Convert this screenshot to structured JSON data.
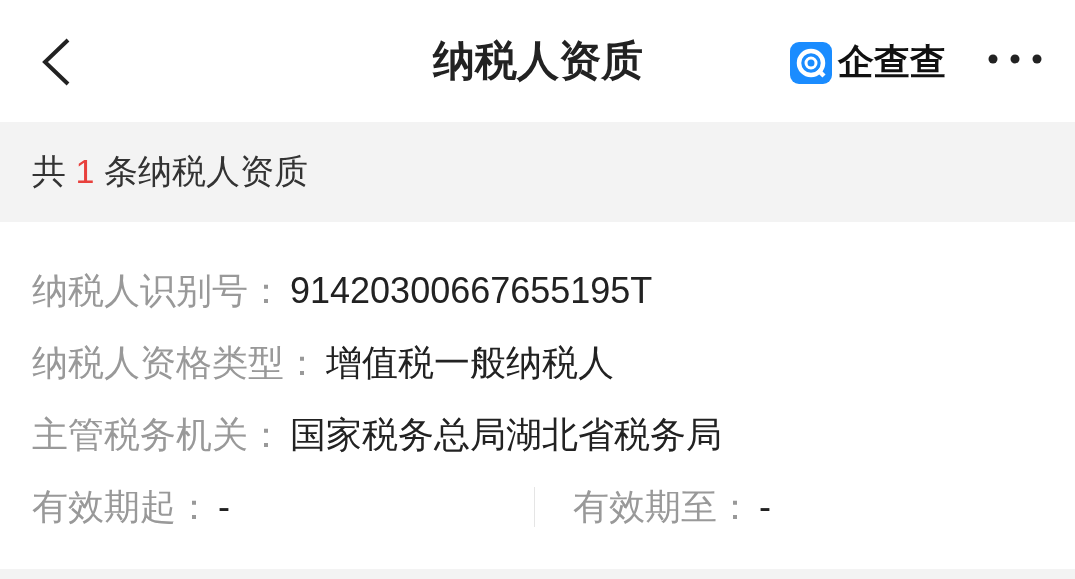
{
  "header": {
    "title": "纳税人资质",
    "brand": "企查查"
  },
  "summary": {
    "prefix": "共",
    "count": "1",
    "suffix": "条纳税人资质"
  },
  "fields": [
    {
      "label": "纳税人识别号：",
      "value": "91420300667655195T"
    },
    {
      "label": "纳税人资格类型：",
      "value": "增值税一般纳税人"
    },
    {
      "label": "主管税务机关：",
      "value": "国家税务总局湖北省税务局"
    }
  ],
  "validity": [
    {
      "label": "有效期起：",
      "value": "-"
    },
    {
      "label": "有效期至：",
      "value": "-"
    }
  ]
}
